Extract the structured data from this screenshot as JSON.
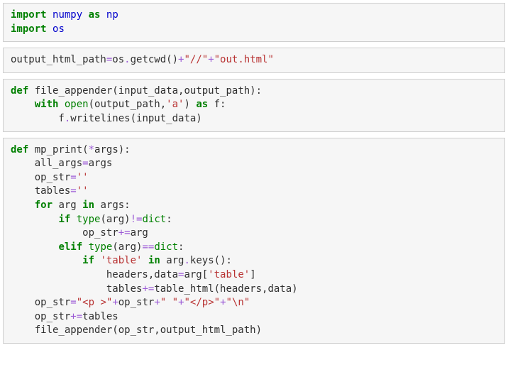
{
  "cells": [
    {
      "lines": [
        [
          {
            "t": "import",
            "c": "kw-green"
          },
          {
            "t": " "
          },
          {
            "t": "numpy",
            "c": "kw-blue"
          },
          {
            "t": " "
          },
          {
            "t": "as",
            "c": "kw-green"
          },
          {
            "t": " "
          },
          {
            "t": "np",
            "c": "kw-blue"
          }
        ],
        [
          {
            "t": "import",
            "c": "kw-green"
          },
          {
            "t": " "
          },
          {
            "t": "os",
            "c": "kw-blue"
          }
        ]
      ]
    },
    {
      "lines": [
        [
          {
            "t": "output_html_path"
          },
          {
            "t": "=",
            "c": "op"
          },
          {
            "t": "os"
          },
          {
            "t": ".",
            "c": "op"
          },
          {
            "t": "getcwd()"
          },
          {
            "t": "+",
            "c": "op"
          },
          {
            "t": "\"//\"",
            "c": "str"
          },
          {
            "t": "+",
            "c": "op"
          },
          {
            "t": "\"out.html\"",
            "c": "str"
          }
        ]
      ]
    },
    {
      "lines": [
        [
          {
            "t": "def",
            "c": "kw-green"
          },
          {
            "t": " file_appender(input_data,output_path):"
          }
        ],
        [
          {
            "t": "    "
          },
          {
            "t": "with",
            "c": "kw-green"
          },
          {
            "t": " "
          },
          {
            "t": "open",
            "c": "builtin"
          },
          {
            "t": "(output_path,"
          },
          {
            "t": "'a'",
            "c": "str"
          },
          {
            "t": ") "
          },
          {
            "t": "as",
            "c": "kw-green"
          },
          {
            "t": " f:"
          }
        ],
        [
          {
            "t": "        f"
          },
          {
            "t": ".",
            "c": "op"
          },
          {
            "t": "writelines(input_data)"
          }
        ]
      ]
    },
    {
      "lines": [
        [
          {
            "t": "def",
            "c": "kw-green"
          },
          {
            "t": " mp_print("
          },
          {
            "t": "*",
            "c": "op"
          },
          {
            "t": "args):"
          }
        ],
        [
          {
            "t": "    all_args"
          },
          {
            "t": "=",
            "c": "op"
          },
          {
            "t": "args"
          }
        ],
        [
          {
            "t": "    op_str"
          },
          {
            "t": "=",
            "c": "op"
          },
          {
            "t": "''",
            "c": "str"
          }
        ],
        [
          {
            "t": "    tables"
          },
          {
            "t": "=",
            "c": "op"
          },
          {
            "t": "''",
            "c": "str"
          }
        ],
        [
          {
            "t": "    "
          },
          {
            "t": "for",
            "c": "kw-green"
          },
          {
            "t": " arg "
          },
          {
            "t": "in",
            "c": "kw-green"
          },
          {
            "t": " args:"
          }
        ],
        [
          {
            "t": "        "
          },
          {
            "t": "if",
            "c": "kw-green"
          },
          {
            "t": " "
          },
          {
            "t": "type",
            "c": "builtin"
          },
          {
            "t": "(arg)"
          },
          {
            "t": "!=",
            "c": "op"
          },
          {
            "t": "dict",
            "c": "builtin"
          },
          {
            "t": ":"
          }
        ],
        [
          {
            "t": "            op_str"
          },
          {
            "t": "+=",
            "c": "op"
          },
          {
            "t": "arg"
          }
        ],
        [
          {
            "t": "        "
          },
          {
            "t": "elif",
            "c": "kw-green"
          },
          {
            "t": " "
          },
          {
            "t": "type",
            "c": "builtin"
          },
          {
            "t": "(arg)"
          },
          {
            "t": "==",
            "c": "op"
          },
          {
            "t": "dict",
            "c": "builtin"
          },
          {
            "t": ":"
          }
        ],
        [
          {
            "t": "            "
          },
          {
            "t": "if",
            "c": "kw-green"
          },
          {
            "t": " "
          },
          {
            "t": "'table'",
            "c": "str"
          },
          {
            "t": " "
          },
          {
            "t": "in",
            "c": "kw-green"
          },
          {
            "t": " arg"
          },
          {
            "t": ".",
            "c": "op"
          },
          {
            "t": "keys():"
          }
        ],
        [
          {
            "t": "                headers,data"
          },
          {
            "t": "=",
            "c": "op"
          },
          {
            "t": "arg["
          },
          {
            "t": "'table'",
            "c": "str"
          },
          {
            "t": "]"
          }
        ],
        [
          {
            "t": "                tables"
          },
          {
            "t": "+=",
            "c": "op"
          },
          {
            "t": "table_html(headers,data)"
          }
        ],
        [
          {
            "t": "    op_str"
          },
          {
            "t": "=",
            "c": "op"
          },
          {
            "t": "\"<p >\"",
            "c": "str"
          },
          {
            "t": "+",
            "c": "op"
          },
          {
            "t": "op_str"
          },
          {
            "t": "+",
            "c": "op"
          },
          {
            "t": "\" \"",
            "c": "str"
          },
          {
            "t": "+",
            "c": "op"
          },
          {
            "t": "\"</p>\"",
            "c": "str"
          },
          {
            "t": "+",
            "c": "op"
          },
          {
            "t": "\"",
            "c": "str"
          },
          {
            "t": "\\n",
            "c": "str"
          },
          {
            "t": "\"",
            "c": "str"
          }
        ],
        [
          {
            "t": "    op_str"
          },
          {
            "t": "+=",
            "c": "op"
          },
          {
            "t": "tables"
          }
        ],
        [
          {
            "t": "    file_appender(op_str,output_html_path)"
          }
        ]
      ]
    }
  ]
}
